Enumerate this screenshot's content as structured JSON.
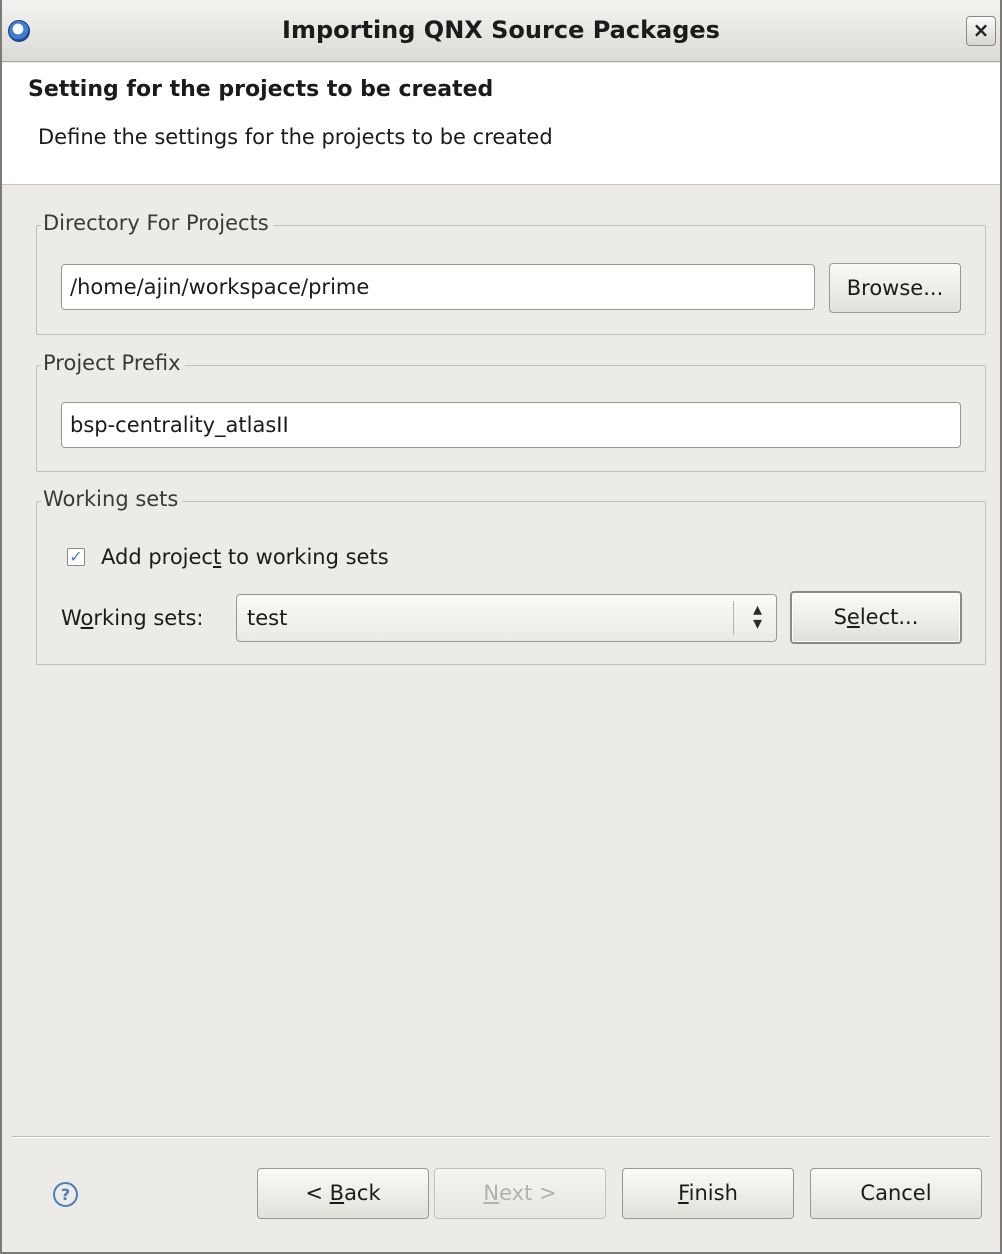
{
  "window": {
    "title": "Importing QNX Source Packages",
    "close_label": "×"
  },
  "header": {
    "title": "Setting for the projects to be created",
    "description": "Define the settings for the projects to be created"
  },
  "directory_group": {
    "label": "Directory For Projects",
    "path_value": "/home/ajin/workspace/prime",
    "browse_label": "Browse..."
  },
  "prefix_group": {
    "label": "Project Prefix",
    "prefix_value": "bsp-centrality_atlasII"
  },
  "working_sets_group": {
    "label": "Working sets",
    "checkbox": {
      "checked": true,
      "check_mark": "✓",
      "label_before": "Add projec",
      "label_mnemonic": "t",
      "label_after": " to working sets"
    },
    "field_label_before": "W",
    "field_label_mnemonic": "o",
    "field_label_after": "rking sets:",
    "selected_set": "test",
    "select_label_before": "S",
    "select_label_mnemonic": "e",
    "select_label_after": "lect..."
  },
  "footer": {
    "help_symbol": "?",
    "back": {
      "before": "< ",
      "mnemonic": "B",
      "after": "ack"
    },
    "next": {
      "mnemonic": "N",
      "after": "ext >",
      "enabled": false
    },
    "finish": {
      "mnemonic": "F",
      "after": "inish"
    },
    "cancel_label": "Cancel"
  },
  "colors": {
    "dialog_bg": "#edebe7",
    "banner_bg": "#ffffff",
    "accent": "#4a7fc0"
  },
  "icons": {
    "title_icon": "qnx-momentics-icon",
    "combo_arrow": "up-down-arrows-icon",
    "help": "help-icon"
  }
}
